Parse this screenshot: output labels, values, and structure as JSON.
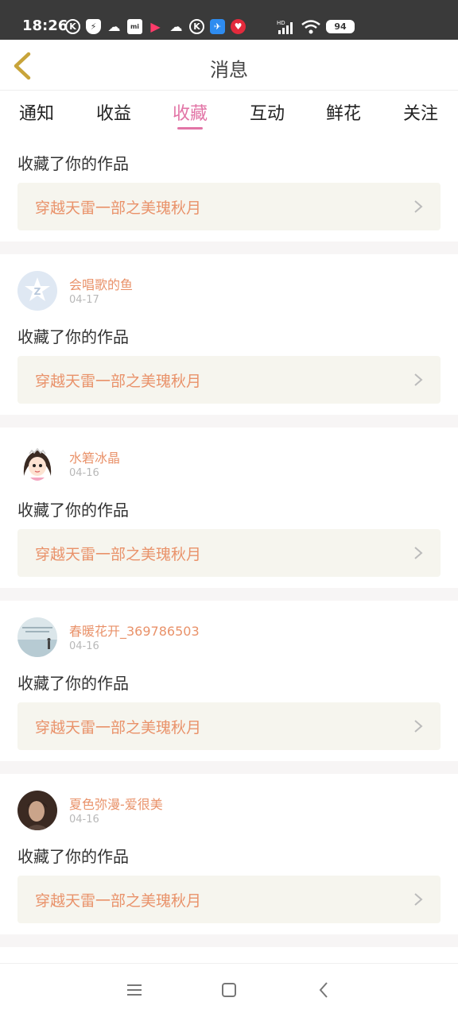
{
  "status_bar": {
    "time": "18:26",
    "battery": "94",
    "signal_label": "HD"
  },
  "header": {
    "title": "消息"
  },
  "tabs": [
    {
      "label": "通知"
    },
    {
      "label": "收益"
    },
    {
      "label": "收藏",
      "active": true
    },
    {
      "label": "互动"
    },
    {
      "label": "鲜花"
    },
    {
      "label": "关注"
    }
  ],
  "colors": {
    "accent": "#e274a6",
    "username": "#e9926a",
    "link_bg": "#f6f5ee"
  },
  "partial_item": {
    "action": "收藏了你的作品",
    "work_title": "穿越天雷一部之美瑰秋月"
  },
  "items": [
    {
      "name": "会唱歌的鱼",
      "date": "04-17",
      "action": "收藏了你的作品",
      "work_title": "穿越天雷一部之美瑰秋月",
      "avatar": "default-avatar-icon"
    },
    {
      "name": "水箬冰晶",
      "date": "04-16",
      "action": "收藏了你的作品",
      "work_title": "穿越天雷一部之美瑰秋月",
      "avatar": "cartoon-girl-avatar"
    },
    {
      "name": "春暖花开_369786503",
      "date": "04-16",
      "action": "收藏了你的作品",
      "work_title": "穿越天雷一部之美瑰秋月",
      "avatar": "landscape-avatar"
    },
    {
      "name": "夏色弥漫-爱很美",
      "date": "04-16",
      "action": "收藏了你的作品",
      "work_title": "穿越天雷一部之美瑰秋月",
      "avatar": "portrait-avatar"
    }
  ]
}
